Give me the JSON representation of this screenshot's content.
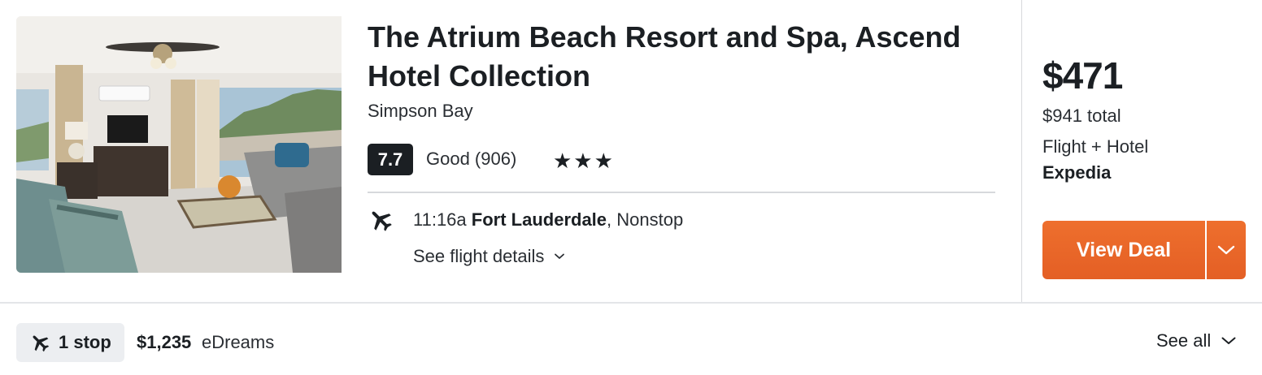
{
  "hotel": {
    "name": "The Atrium Beach Resort and Spa, Ascend Hotel Collection",
    "location": "Simpson Bay",
    "rating_score": "7.7",
    "rating_text": "Good (906)",
    "stars": "★★★",
    "star_count": 3
  },
  "flight": {
    "time": "11:16a",
    "origin": "Fort Lauderdale",
    "stops": ", Nonstop",
    "details_label": "See flight details"
  },
  "deal": {
    "price": "$471",
    "total": "$941 total",
    "package": "Flight + Hotel",
    "provider": "Expedia",
    "button_label": "View Deal"
  },
  "alternative": {
    "stop_label": "1 stop",
    "price": "$1,235",
    "provider": "eDreams",
    "see_all_label": "See all"
  },
  "colors": {
    "accent": "#e8672a",
    "dark": "#1b1f23",
    "chip_bg": "#eceef1"
  },
  "icons": {
    "plane": "plane-icon",
    "chevron": "chevron-down-icon"
  }
}
